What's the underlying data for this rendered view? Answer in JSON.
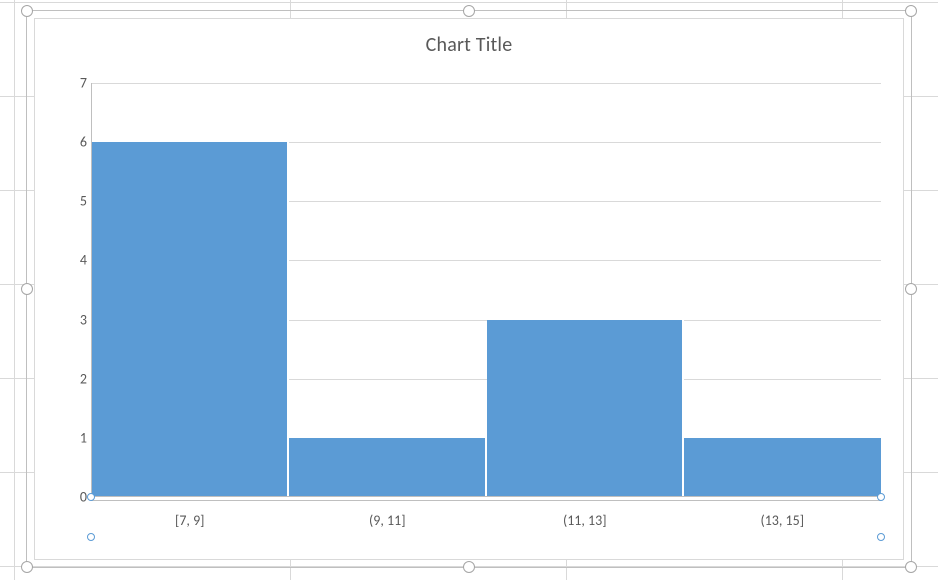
{
  "chart_data": {
    "type": "bar",
    "title": "Chart Title",
    "categories": [
      "[7, 9]",
      "(9, 11]",
      "(11, 13]",
      "(13, 15]"
    ],
    "values": [
      6,
      1,
      3,
      1
    ],
    "ylim": [
      0,
      7
    ],
    "yticks": [
      0,
      1,
      2,
      3,
      4,
      5,
      6,
      7
    ],
    "xlabel": "",
    "ylabel": "",
    "bar_color": "#5B9BD5",
    "gridline_color": "#d9d9d9"
  }
}
